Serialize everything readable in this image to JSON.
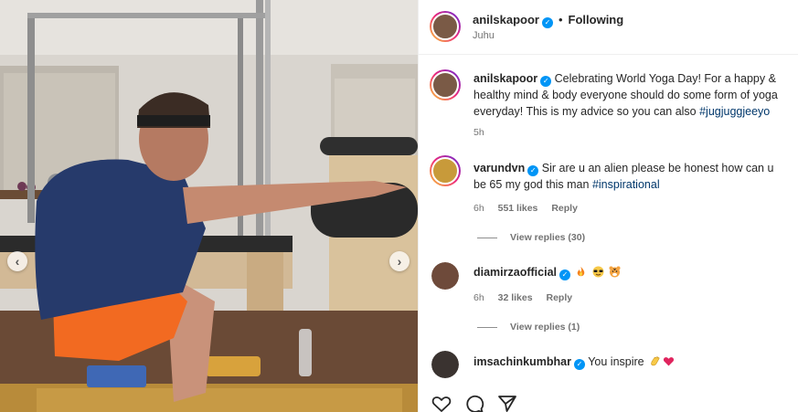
{
  "post": {
    "author": "anilskapoor",
    "follow_status": "Following",
    "separator": "•",
    "location": "Juhu"
  },
  "caption": {
    "user": "anilskapoor",
    "text": "Celebrating World Yoga Day! For a happy & healthy mind & body everyone should do some form of yoga everyday! This is my advice so you can also ",
    "hashtag": "#jugjuggjeeyo",
    "time": "5h"
  },
  "comments": [
    {
      "user": "varundvn",
      "text": "Sir are u an alien please be honest how can u be 65 my god this man ",
      "hashtag": "#inspirational",
      "time": "6h",
      "likes": "551 likes",
      "reply_label": "Reply",
      "view_replies": "View replies (30)"
    },
    {
      "user": "diamirzaofficial",
      "text": "",
      "emojis": [
        "fire-icon",
        "sunglasses-face-icon",
        "tiger-face-icon"
      ],
      "time": "6h",
      "likes": "32 likes",
      "reply_label": "Reply",
      "view_replies": "View replies (1)"
    },
    {
      "user": "imsachinkumbhar",
      "text": "You inspire ",
      "emojis": [
        "clapping-hands-icon",
        "red-heart-icon"
      ]
    }
  ],
  "actions": [
    "heart-icon",
    "comment-icon",
    "share-icon"
  ],
  "colors": {
    "verified": "#0095f6",
    "hashtag": "#00376b",
    "muted": "#737373",
    "shorts": "#f26a21",
    "block": "#3f68b5"
  }
}
